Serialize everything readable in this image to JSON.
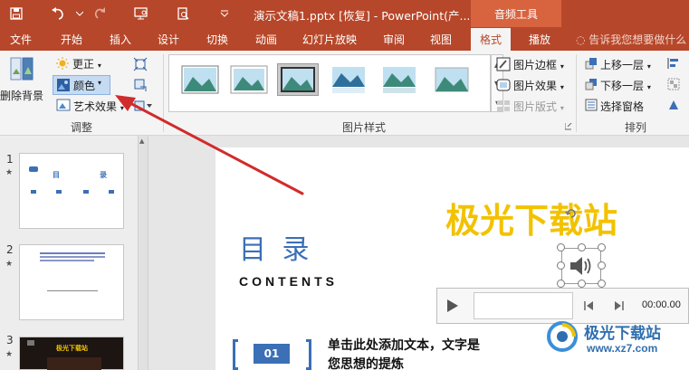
{
  "titlebar": {
    "doc_title": "演示文稿1.pptx [恢复] - PowerPoint(产...",
    "context_tab": "音频工具"
  },
  "tabs": [
    "文件",
    "开始",
    "插入",
    "设计",
    "切换",
    "动画",
    "幻灯片放映",
    "审阅",
    "视图",
    "格式",
    "播放"
  ],
  "active_tab": "格式",
  "tell_me": "告诉我您想要做什么",
  "ribbon": {
    "remove_bg": "删除背景",
    "corrections": "更正",
    "color": "颜色",
    "artistic": "艺术效果",
    "adjust_group": "调整",
    "picture_styles_group": "图片样式",
    "border": "图片边框",
    "effects": "图片效果",
    "layout": "图片版式",
    "bring_forward": "上移一层",
    "send_backward": "下移一层",
    "selection_pane": "选择窗格",
    "arrange_group": "排列"
  },
  "thumbnails": [
    {
      "num": "1",
      "star": "★",
      "t1": "目",
      "t2": "录"
    },
    {
      "num": "2",
      "star": "★"
    },
    {
      "num": "3",
      "star": "★",
      "t1": "极光下载站"
    }
  ],
  "slide": {
    "title": "目 录",
    "subtitle": "CONTENTS",
    "watermark": "极光下载站",
    "item_number": "01",
    "item_text_line1": "单击此处添加文本，文字是",
    "item_text_line2": "您思想的提炼"
  },
  "player": {
    "time": "00:00.00"
  },
  "site_logo": {
    "name": "极光下载站",
    "url": "www.xz7.com"
  },
  "colors": {
    "accent": "#b7472a",
    "gold": "#f2c200",
    "blue": "#3b6fb6"
  }
}
